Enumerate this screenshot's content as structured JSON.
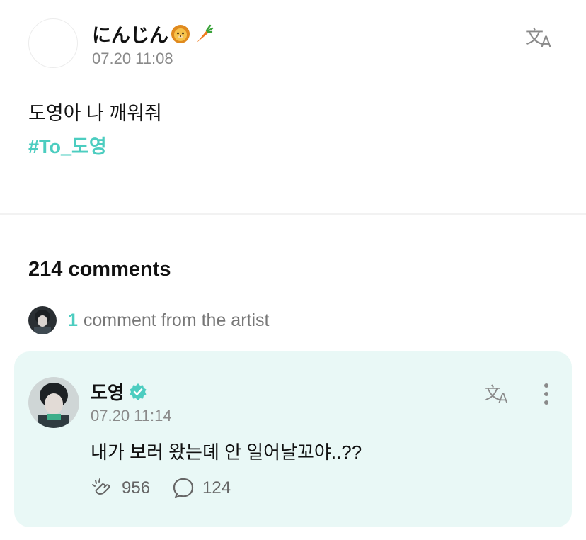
{
  "post": {
    "author_name": "にんじん",
    "author_emojis": [
      "lion-emoji",
      "carrot-emoji"
    ],
    "time": "07.20 11:08",
    "text": "도영아 나 깨워줘",
    "hashtag": "#To_도영",
    "translate_icon": "translate-icon"
  },
  "comments": {
    "count_label": "214 comments",
    "artist_count": "1",
    "artist_label": "comment from the artist"
  },
  "artist_comment": {
    "name": "도영",
    "verified_icon": "verified-badge-icon",
    "time": "07.20 11:14",
    "text": "내가 보러 왔는뎨 안 일어날꼬야..??",
    "likes": "956",
    "replies": "124",
    "more_icon": "more-vertical-icon"
  },
  "colors": {
    "accent": "#4ccdc0",
    "card_bg": "#e9f8f6",
    "muted_text": "#8a8a8a"
  }
}
